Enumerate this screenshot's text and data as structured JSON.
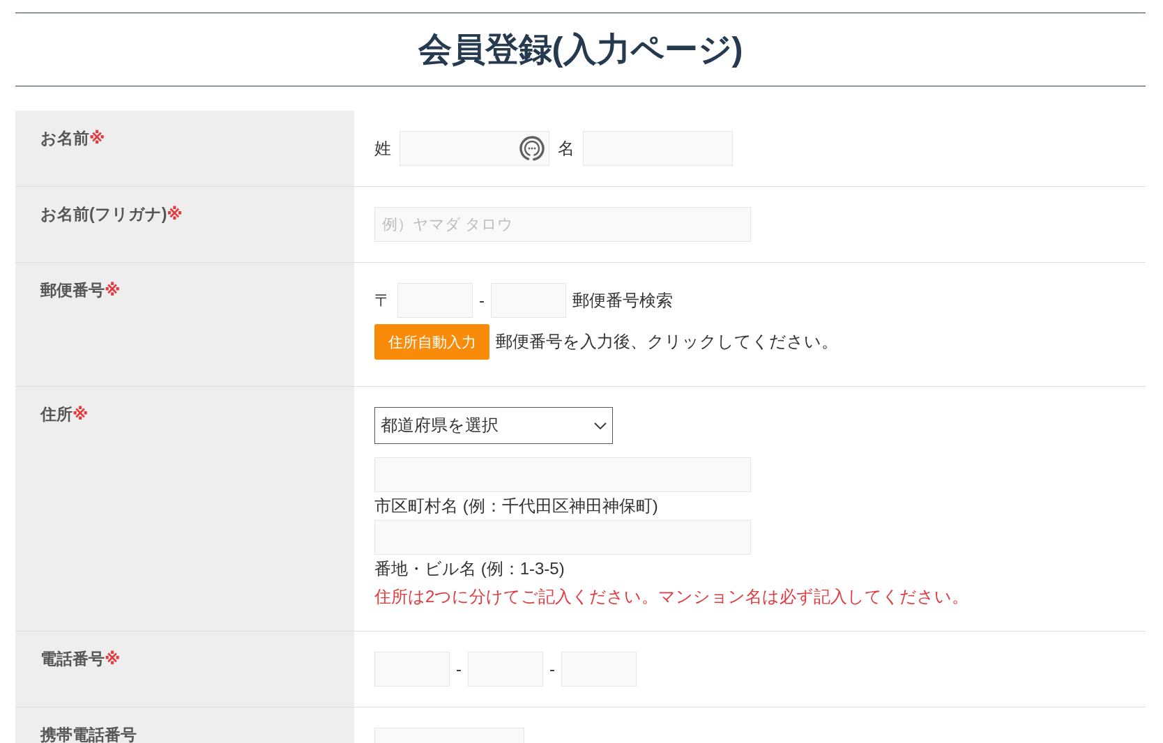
{
  "title": "会員登録(入力ページ)",
  "rows": [
    {
      "kind": "name_pair",
      "label": "お名前",
      "required_mark": "※",
      "parts": [
        {
          "label": "姓",
          "autofill_icon": true
        },
        {
          "label": "名",
          "autofill_icon": false
        }
      ]
    },
    {
      "kind": "text",
      "label": "お名前(フリガナ)",
      "required_mark": "※",
      "placeholder": "例）ヤマダ タロウ"
    },
    {
      "kind": "postal",
      "label": "郵便番号",
      "required_mark": "※",
      "prefix": "〒",
      "separator": "-",
      "search_label": "郵便番号検索",
      "button": "住所自動入力",
      "hint": "郵便番号を入力後、クリックしてください。"
    },
    {
      "kind": "address",
      "label": "住所",
      "required_mark": "※",
      "select_value": "都道府県を選択",
      "lines": [
        {
          "caption": "市区町村名 (例：千代田区神田神保町)"
        },
        {
          "caption": "番地・ビル名 (例：1-3-5)"
        }
      ],
      "note": "住所は2つに分けてご記入ください。マンション名は必ず記入してください。"
    },
    {
      "kind": "phone",
      "label": "電話番号",
      "required_mark": "※",
      "separators": [
        "-",
        "-"
      ]
    },
    {
      "kind": "single",
      "label": "携帯電話番号"
    }
  ]
}
